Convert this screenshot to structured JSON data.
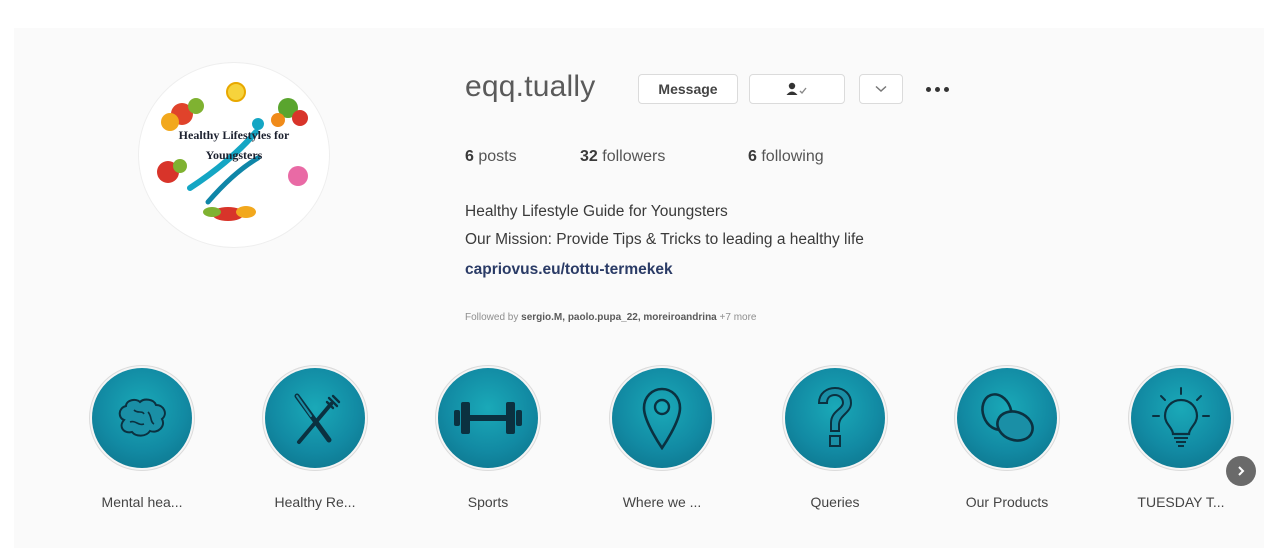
{
  "profile": {
    "username": "eqq.tually",
    "avatar_text_line1": "Healthy Lifestyles for",
    "avatar_text_line2": "Youngsters",
    "message_button": "Message",
    "follow_icon": "person-check-icon",
    "dropdown_icon": "chevron-down-icon",
    "more_icon": "more-options-icon"
  },
  "stats": {
    "posts_count": "6",
    "posts_label": "posts",
    "followers_count": "32",
    "followers_label": "followers",
    "following_count": "6",
    "following_label": "following"
  },
  "bio": {
    "line1": "Healthy Lifestyle Guide for Youngsters",
    "line2": "Our Mission: Provide Tips & Tricks to leading a healthy life",
    "link": "capriovus.eu/tottu-termekek",
    "followed_by_prefix": "Followed by",
    "followed_by_names": "sergio.M, paolo.pupa_22, moreiroandrina",
    "followed_by_more": "+7 more"
  },
  "highlights": [
    {
      "label": "Mental hea...",
      "icon": "brain-icon"
    },
    {
      "label": "Healthy Re...",
      "icon": "fork-knife-icon"
    },
    {
      "label": "Sports",
      "icon": "dumbbell-icon"
    },
    {
      "label": "Where we ...",
      "icon": "map-pin-icon"
    },
    {
      "label": "Queries",
      "icon": "question-mark-icon"
    },
    {
      "label": "Our Products",
      "icon": "eggs-icon"
    },
    {
      "label": "TUESDAY T...",
      "icon": "lightbulb-icon"
    }
  ],
  "next_icon": "chevron-right-icon",
  "colors": {
    "highlight_teal": "#128aa3",
    "link": "#2a3b66"
  }
}
